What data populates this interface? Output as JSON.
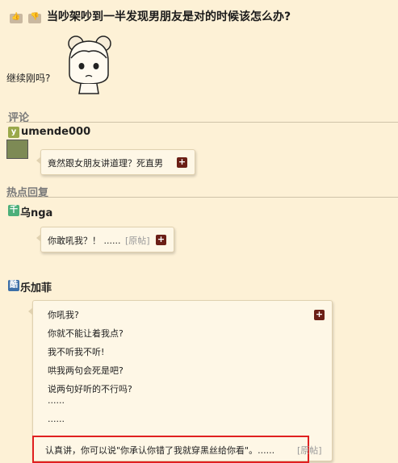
{
  "post": {
    "title": "当吵架吵到一半发现男朋友是对的时候该怎么办?",
    "like_label": "👍",
    "dislike_label": "👎",
    "caption": "继续刚吗?"
  },
  "comments_section": {
    "title": "评论",
    "user_badge": "y",
    "user": "umende000",
    "text": "竟然跟女朋友讲道理？死直男"
  },
  "hot_section": {
    "title": "热点回复",
    "replies": [
      {
        "badge": "千",
        "user": "乌nga",
        "text": "你敢吼我？！ ......",
        "original": "[原帖]"
      },
      {
        "badge": "酷",
        "user": "乐加菲",
        "lines": [
          "你吼我?",
          "你就不能让着我点?",
          "我不听我不听!",
          "哄我两句会死是吧?",
          "说两句好听的不行吗?",
          "......",
          "......"
        ],
        "highlight": "认真讲，你可以说\"你承认你错了我就穿黑丝给你看\"。......",
        "original": "[原帖]"
      }
    ]
  },
  "plus_label": "+",
  "colors": {
    "background": "#fdf1d6",
    "plus_button": "#6b1f16",
    "highlight_border": "#e02020",
    "badge_y": "#9aa84a",
    "badge_qian": "#4caf7a",
    "badge_ku": "#3d6fa8"
  }
}
